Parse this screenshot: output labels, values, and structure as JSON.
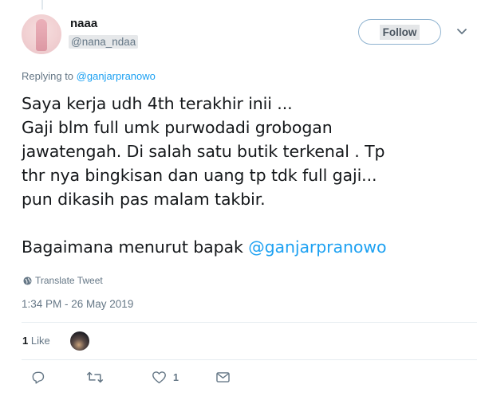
{
  "author": {
    "name": "naaa",
    "handle": "@nana_ndaa"
  },
  "follow_button": {
    "label": "Follow"
  },
  "reply_context": {
    "prefix": "Replying to",
    "mention": "@ganjarpranowo"
  },
  "tweet": {
    "lines": [
      "Saya kerja udh 4th terakhir inii ...",
      "Gaji blm full umk purwodadi grobogan",
      "jawatengah. Di salah satu butik terkenal . Tp",
      "thr nya bingkisan dan uang tp tdk full gaji...",
      "pun dikasih pas malam takbir."
    ],
    "closing_text": "Bagaimana menurut bapak",
    "closing_mention": "@ganjarpranowo"
  },
  "translate_label": "Translate Tweet",
  "timestamp": "1:34 PM - 26 May 2019",
  "stats": {
    "likes_count": "1",
    "likes_label": "Like"
  },
  "actions": {
    "reply_icon": "reply-icon",
    "retweet_icon": "retweet-icon",
    "like_icon": "heart-icon",
    "like_count": "1",
    "dm_icon": "envelope-icon"
  },
  "colors": {
    "accent": "#1da1f2",
    "muted": "#657786",
    "text": "#14171a"
  }
}
